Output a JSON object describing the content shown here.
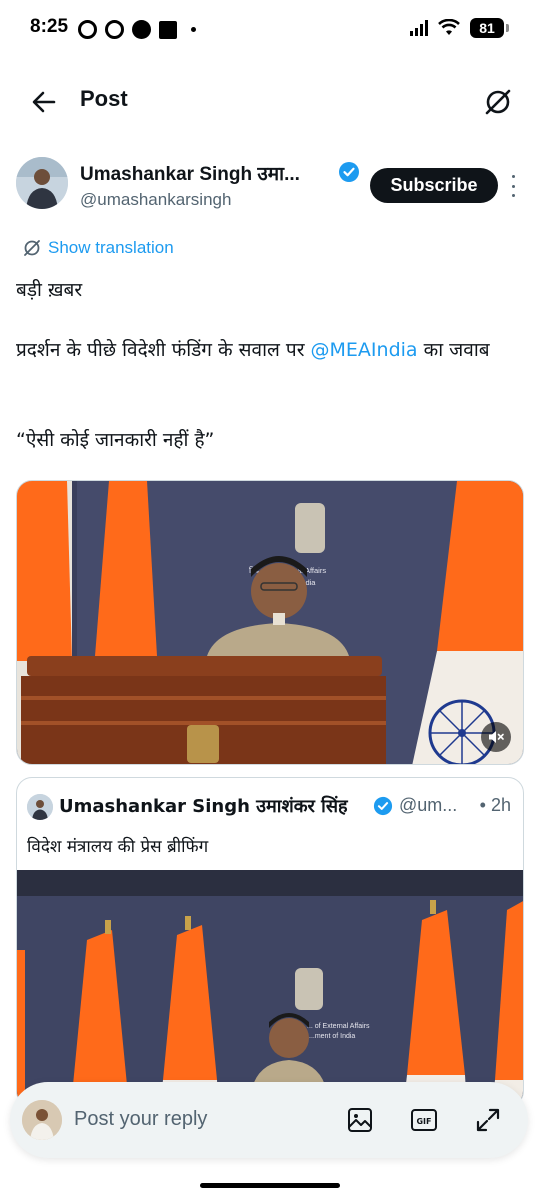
{
  "status_bar": {
    "time": "8:25",
    "battery": "81"
  },
  "header": {
    "title": "Post",
    "back_icon": "arrow-left-icon",
    "grok_icon": "grok-icon"
  },
  "author": {
    "name": "Umashankar Singh उमा...",
    "handle": "@umashankarsingh",
    "verified": true,
    "subscribe_label": "Subscribe"
  },
  "translation": {
    "label": "Show translation"
  },
  "post": {
    "line1": "बड़ी ख़बर",
    "line2_before": "प्रदर्शन के पीछे विदेशी फंडिंग के सवाल पर ",
    "mention": "@MEAIndia",
    "line2_after": " का जवाब",
    "line3": "“ऐसी कोई जानकारी नहीं है”"
  },
  "media": {
    "banner_line1": "विदे... of External Affairs",
    "banner_line2": "...ernment of India",
    "mute_icon": "volume-muted-icon"
  },
  "quote": {
    "name": "Umashankar Singh उमाशंकर सिंह",
    "handle": "@um...",
    "time": "• 2h",
    "text": "विदेश मंत्रालय की प्रेस ब्रीफिंग",
    "banner_line1": "... of External Affairs",
    "banner_line2": "...ment of India"
  },
  "reply": {
    "placeholder": "Post your reply",
    "image_icon": "image-icon",
    "gif_label": "GIF",
    "expand_icon": "expand-icon"
  },
  "colors": {
    "accent": "#1d9bf0",
    "text": "#0f1419",
    "muted": "#536471",
    "saffron": "#ff6a1a",
    "backdrop": "#3a3f5c"
  }
}
